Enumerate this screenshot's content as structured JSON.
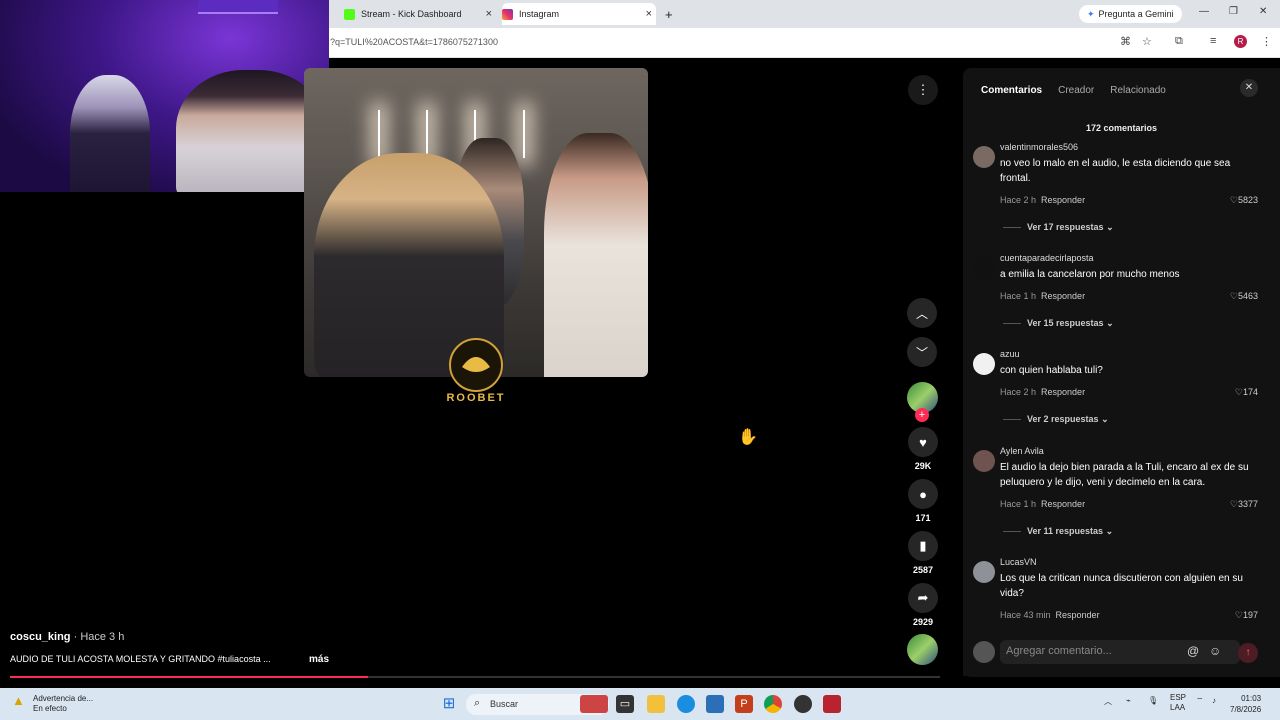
{
  "browser": {
    "tabs": [
      {
        "label": "Stream - Kick Dashboard",
        "icon": "kick-icon",
        "color": "#53fc18"
      },
      {
        "label": "Instagram",
        "icon": "instagram-icon",
        "color": "#e1306c"
      }
    ],
    "new_tab": "+",
    "url": "?q=TULI%20ACOSTA&t=1786075271300",
    "gemini_label": "Pregunta a Gemini",
    "profile_initial": "R"
  },
  "video": {
    "logo_text": "ROOBET"
  },
  "actions": {
    "likes": "29K",
    "comments": "171",
    "saves": "2587",
    "shares": "2929"
  },
  "post": {
    "author": "coscu_king",
    "time": "· Hace 3 h",
    "description": "AUDIO DE TULI ACOSTA MOLESTA Y GRITANDO #tuliacosta ...",
    "more": "más",
    "progress": 0.385
  },
  "panel": {
    "tabs": [
      "Comentarios",
      "Creador",
      "Relacionado"
    ],
    "comment_count": "172 comentarios",
    "comments": [
      {
        "user": "valentinmorales506",
        "text": "no veo lo malo en el audio, le esta diciendo que sea frontal.",
        "time": "Hace 2 h",
        "reply": "Responder",
        "likes": "5823",
        "more_replies": "Ver 17 respuestas"
      },
      {
        "user": "cuentaparadecirlaposta",
        "text": "a emilia la cancelaron por mucho menos",
        "time": "Hace 1 h",
        "reply": "Responder",
        "likes": "5463",
        "more_replies": "Ver 15 respuestas"
      },
      {
        "user": "azuu",
        "text": "con quien hablaba tuli?",
        "time": "Hace 2 h",
        "reply": "Responder",
        "likes": "174",
        "more_replies": "Ver 2 respuestas"
      },
      {
        "user": "Aylen Avila",
        "text": "El audio la dejo bien parada a la Tuli, encaro al ex de su peluquero y le dijo, veni y decimelo en la cara.",
        "time": "Hace 1 h",
        "reply": "Responder",
        "likes": "3377",
        "more_replies": "Ver 11 respuestas"
      },
      {
        "user": "LucasVN",
        "text": "Los que la critican nunca discutieron con alguien en su vida?",
        "time": "Hace 43 min",
        "reply": "Responder",
        "likes": "197"
      }
    ],
    "add_placeholder": "Agregar comentario...",
    "mention": "@",
    "emoji": "☺"
  },
  "taskbar": {
    "warning_line1": "Advertencia de...",
    "warning_line2": "En efecto",
    "search_label": "Buscar",
    "lang_line1": "ESP",
    "lang_line2": "LAA",
    "time": "01:03",
    "date": "7/8/2026"
  }
}
